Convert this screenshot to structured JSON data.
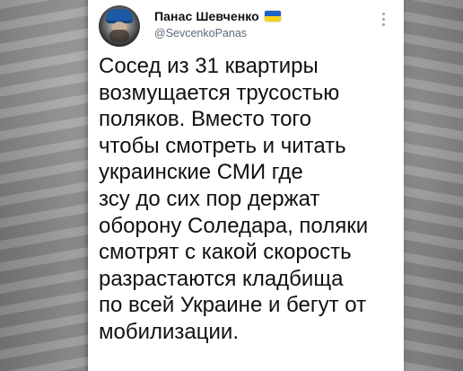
{
  "header": {
    "display_name": "Панас Шевченко",
    "handle": "@SevcenkoPanas",
    "avatar_icon": "profile-avatar",
    "flag_icon": "ukraine-flag-icon"
  },
  "tweet": {
    "lines": [
      "Сосед из 31 квартиры",
      "возмущается трусостью",
      "поляков. Вместо того",
      "чтобы смотреть и читать",
      "украинские СМИ где",
      "зсу до сих пор держат",
      "оборону Соледара, поляки",
      "смотрят с какой скорость",
      "разрастаются кладбища",
      "по всей Украине и бегут от",
      "мобилизации."
    ]
  },
  "colors": {
    "text": "#111111",
    "muted": "#5b6b7a",
    "background": "#ffffff"
  }
}
